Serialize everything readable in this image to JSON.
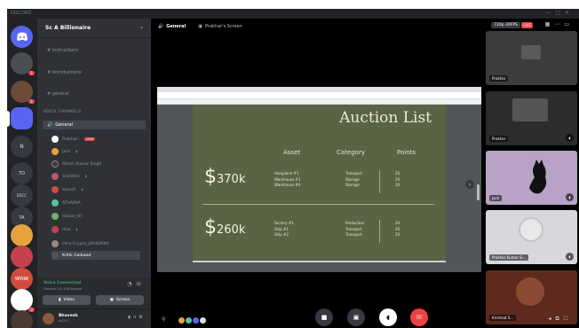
{
  "window": {
    "brand": "DISCORD",
    "controls": [
      "—",
      "▢",
      "✕"
    ]
  },
  "server_list": [
    {
      "label": "",
      "icon": "discord-logo"
    },
    {
      "label": "",
      "badge": "1"
    },
    {
      "label": "",
      "badge": "1"
    },
    {
      "label": "",
      "selected": true
    },
    {
      "label": "N"
    },
    {
      "label": "TO"
    },
    {
      "label": "DSCC"
    },
    {
      "label": "TA"
    },
    {
      "label": ""
    },
    {
      "label": ""
    },
    {
      "label": "WOW"
    },
    {
      "label": "",
      "badge": "2"
    },
    {
      "label": ""
    }
  ],
  "channel_sidebar": {
    "server_name": "Sc A Billionaire",
    "text_channels": [
      "# instructions",
      "# introductions",
      "# general"
    ],
    "category": "VOICE CHANNELS",
    "voice_channel": "General",
    "voice_users": [
      {
        "name": "Prakhar",
        "color": "#ffffff",
        "live": "LIVE"
      },
      {
        "name": "Jack",
        "color": "#e8a33d"
      },
      {
        "name": "Ritesh Kumar Singh",
        "color": "#3a3a3a"
      },
      {
        "name": "Srishtikh",
        "color": "#b8576b"
      },
      {
        "name": "aarush",
        "color": "#d14b3c"
      },
      {
        "name": "ATHARVA",
        "color": "#57c4a0"
      },
      {
        "name": "Ishaan_07",
        "color": "#6db36a"
      },
      {
        "name": "Hiro",
        "color": "#c4424f"
      },
      {
        "name": "Infra-Crypto_JOHN3000",
        "color": "#9a8a7a"
      },
      {
        "name": "Kritik Gaikwad",
        "color": "#4f545c"
      }
    ]
  },
  "voice_panel": {
    "status": "Voice Connected",
    "subtitle": "General / Sc A Billionaire",
    "video_label": "Video",
    "screen_label": "Screen"
  },
  "user": {
    "name": "Bhavesh",
    "tag": "#4257"
  },
  "stage": {
    "channel": "General",
    "stream_title": "Prakhar's Screen",
    "quality": "720p 30FPS",
    "live": "LIVE"
  },
  "slide": {
    "title": "Auction List",
    "headers": [
      "Asset",
      "Category",
      "Points"
    ],
    "rows": [
      {
        "price_symbol": "$",
        "price": "370k",
        "assets": [
          "Aeroplane #1",
          "Warehouse #1",
          "Warehouse #4"
        ],
        "categories": [
          "Transport",
          "Storage",
          "Storage"
        ],
        "points": [
          "20",
          "20",
          "20"
        ]
      },
      {
        "price_symbol": "$",
        "price": "260k",
        "assets": [
          "Factory #1",
          "Ship #1",
          "Ship #2"
        ],
        "categories": [
          "Production",
          "Transport",
          "Transport"
        ],
        "points": [
          "20",
          "20",
          "20"
        ]
      }
    ]
  },
  "tiles": [
    {
      "label": "Prakhar",
      "color": "#3c3c3c"
    },
    {
      "label": "Prakhar",
      "color": "#2a2c2e"
    },
    {
      "label": "Jack",
      "color": "#b8a2c6"
    },
    {
      "label": "Prakhar Kumar Si...",
      "color": "#d6d8db"
    },
    {
      "label": "Krishnat S...",
      "color": "#5d2a1d"
    }
  ],
  "controls": {
    "camera_icon": "video-camera-icon",
    "screen_icon": "screen-share-icon",
    "mic_icon": "microphone-icon",
    "disconnect_icon": "disconnect-icon"
  },
  "activity_dots": [
    "#e8a33d",
    "#57c4a0",
    "#5865f2",
    "#dcddde"
  ]
}
